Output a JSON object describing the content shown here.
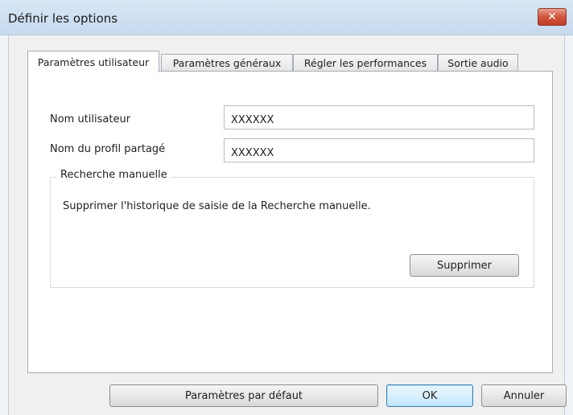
{
  "window": {
    "title": "Définir les options",
    "close_glyph": "✕"
  },
  "tabs": [
    {
      "label": "Paramètres utilisateur",
      "active": true
    },
    {
      "label": "Paramètres généraux",
      "active": false
    },
    {
      "label": "Régler les performances",
      "active": false
    },
    {
      "label": "Sortie audio",
      "active": false
    }
  ],
  "user_settings": {
    "username": {
      "label": "Nom utilisateur",
      "value": "XXXXXX"
    },
    "shared_profile": {
      "label": "Nom du profil partagé",
      "value": "XXXXXX"
    },
    "manual_search": {
      "group_title": "Recherche manuelle",
      "description": "Supprimer l'historique de saisie de la Recherche manuelle.",
      "delete_label": "Supprimer"
    }
  },
  "footer": {
    "defaults_label": "Paramètres par défaut",
    "ok_label": "OK",
    "cancel_label": "Annuler"
  },
  "colors": {
    "titlebar": "#c6d9ee",
    "close_button": "#d0543c",
    "default_button_border": "#3c7fb1"
  },
  "icons": {
    "close": "close-icon"
  }
}
